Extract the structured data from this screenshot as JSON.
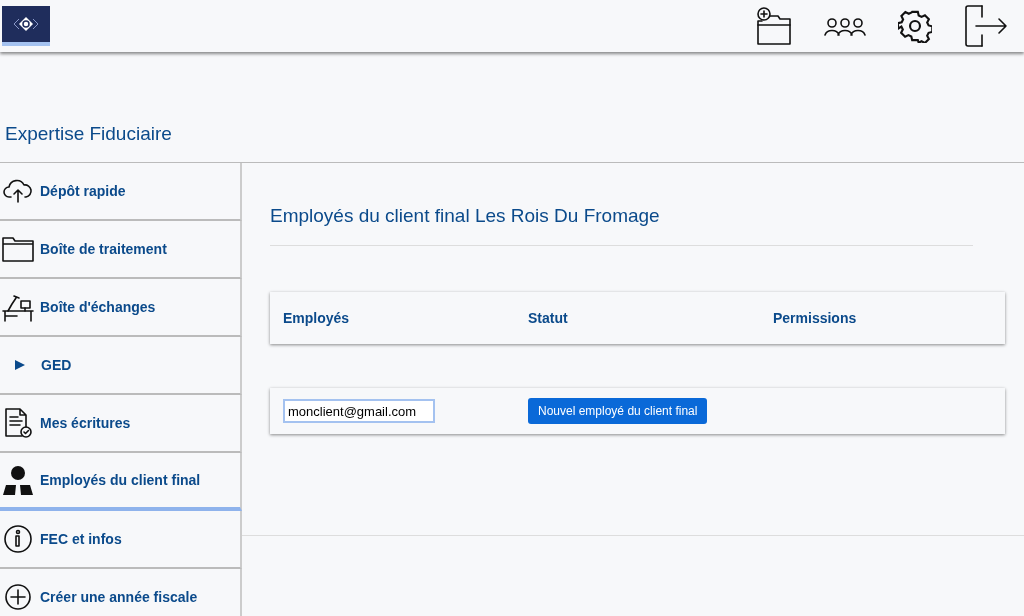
{
  "app": {
    "title": "Expertise Fiduciaire"
  },
  "sidebar": {
    "items": [
      {
        "label": "Dépôt rapide",
        "selected": false
      },
      {
        "label": "Boîte de traitement",
        "selected": false
      },
      {
        "label": "Boîte d'échanges",
        "selected": false
      },
      {
        "label": "GED",
        "selected": false
      },
      {
        "label": "Mes écritures",
        "selected": false
      },
      {
        "label": "Employés du client final",
        "selected": true
      },
      {
        "label": "FEC et infos",
        "selected": false
      },
      {
        "label": "Créer une année fiscale",
        "selected": false
      }
    ]
  },
  "main": {
    "title": "Employés du client final Les Rois Du Fromage",
    "table": {
      "columns": [
        "Employés",
        "Statut",
        "Permissions"
      ]
    },
    "new_employee": {
      "email": "monclient@gmail.com",
      "button": "Nouvel employé du client final"
    }
  }
}
